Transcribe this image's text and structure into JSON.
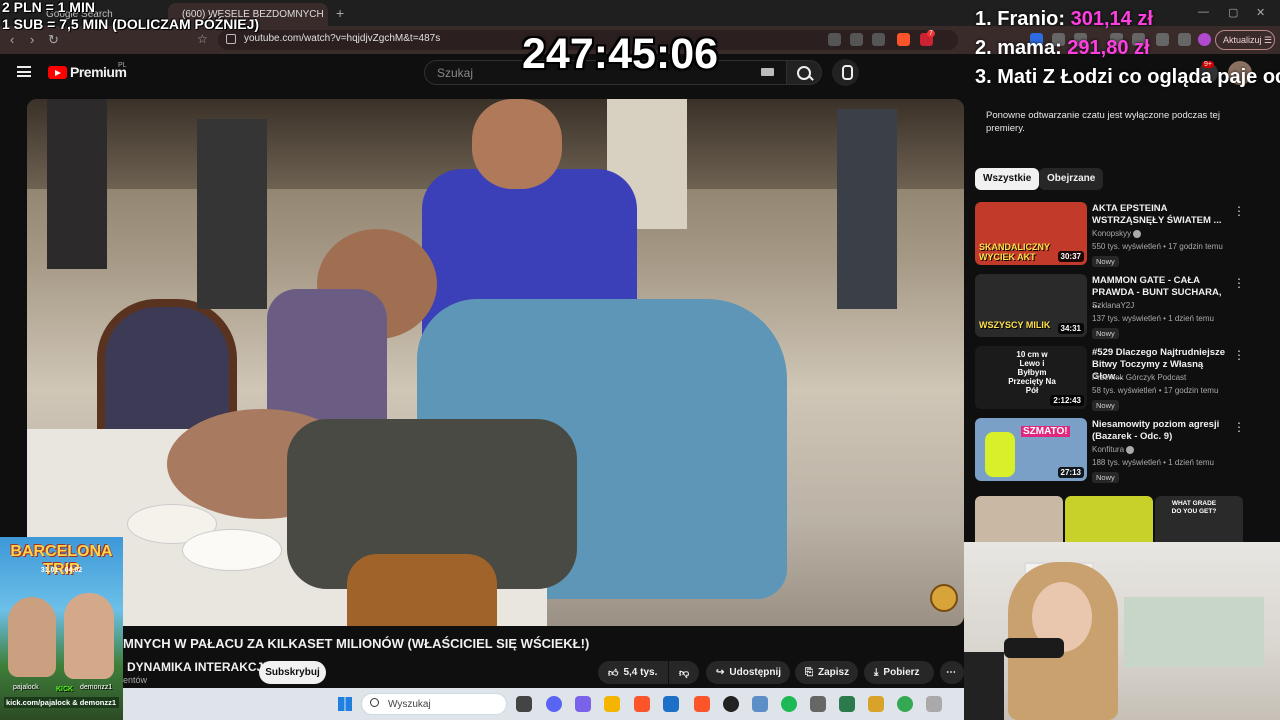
{
  "browser": {
    "tabs": [
      {
        "label": "Google Search"
      },
      {
        "label": "(600) WESELE BEZDOMNYCH"
      }
    ],
    "url": "youtube.com/watch?v=hqjdjvZgchM&t=487s",
    "update_label": "Aktualizuj",
    "notification_count": "7"
  },
  "youtube": {
    "logo_text": "Premium",
    "logo_region": "PL",
    "search_placeholder": "Szukaj",
    "header_notifications": "9+",
    "video_title": "MNYCH W PAŁACU ZA KILKASET MILIONÓW (WŁAŚCICIEL SIĘ WŚCIEKŁ!)",
    "channel_name": "DYNAMIKA INTERAKCJI",
    "channel_subs": "entów",
    "subscribe_label": "Subskrybuj",
    "like_count": "5,4 tys.",
    "share_label": "Udostępnij",
    "save_label": "Zapisz",
    "download_label": "Pobierz",
    "chat_notice": "Ponowne odtwarzanie czatu jest wyłączone podczas tej premiery.",
    "chips": [
      "Wszystkie",
      "Obejrzane"
    ],
    "recommendations": [
      {
        "title": "AKTA EPSTEINA WSTRZĄSNĘŁY ŚWIATEM ...",
        "channel": "Konopskyy",
        "meta": "550 tys. wyświetleń • 17 godzin temu",
        "badge": "Nowy",
        "duration": "30:37",
        "thumb_text": "SKANDALICZNY WYCIEK AKT",
        "thumb_color": "#c23a2a"
      },
      {
        "title": "MAMMON GATE - CAŁA PRAWDA - BUNT SUCHARA, ...",
        "channel": "SzklanaY2J",
        "meta": "137 tys. wyświetleń • 1 dzień temu",
        "badge": "Nowy",
        "duration": "34:31",
        "thumb_text": "WSZYSCY MILIK",
        "thumb_color": "#2a2a2a"
      },
      {
        "title": "#529 Dlaczego Najtrudniejsze Bitwy Toczymy z Własną Głow...",
        "channel": "Przemek Górczyk Podcast",
        "meta": "58 tys. wyświetleń • 17 godzin temu",
        "badge": "Nowy",
        "duration": "2:12:43",
        "thumb_text": "10 cm w Lewo i Byłbym Przecięty Na Pół",
        "thumb_color": "#1b1b1b"
      },
      {
        "title": "Niesamowity poziom agresji (Bazarek - Odc. 9)",
        "channel": "Konfitura",
        "meta": "188 tys. wyświetleń • 1 dzień temu",
        "badge": "Nowy",
        "duration": "27:13",
        "thumb_text": "SZMATO!",
        "thumb_color": "#7aa0c8"
      }
    ],
    "partial_thumb_text": "WHAT GRADE DO YOU GET?"
  },
  "taskbar": {
    "search_placeholder": "Wyszukaj"
  },
  "overlay": {
    "rate_line_1": "2 PLN = 1 MIN",
    "rate_line_2": "1 SUB = 7,5 MIN (DOLICZAM PÓŹNIEJ)",
    "timer": "247:45:06",
    "leaderboard": [
      {
        "rank": "1.",
        "name": "Franio:",
        "amount": "301,14 zł"
      },
      {
        "rank": "2.",
        "name": "mama:",
        "amount": "291,80 zł"
      },
      {
        "rank": "3.",
        "name": "Mati Z Łodzi co ogląda paje oc",
        "amount": ""
      }
    ],
    "promo": {
      "title": "BARCELONA TRIP",
      "dates": "31.01 - 04.02",
      "kick": "KICK",
      "name_left": "pajalock",
      "name_right": "demonzz1",
      "url": "kick.com/pajalock & demonzz1"
    }
  },
  "colors": {
    "accent": "#ff0000",
    "leaderboard_amount": "#ff3fe0",
    "kick": "#53fc18"
  }
}
